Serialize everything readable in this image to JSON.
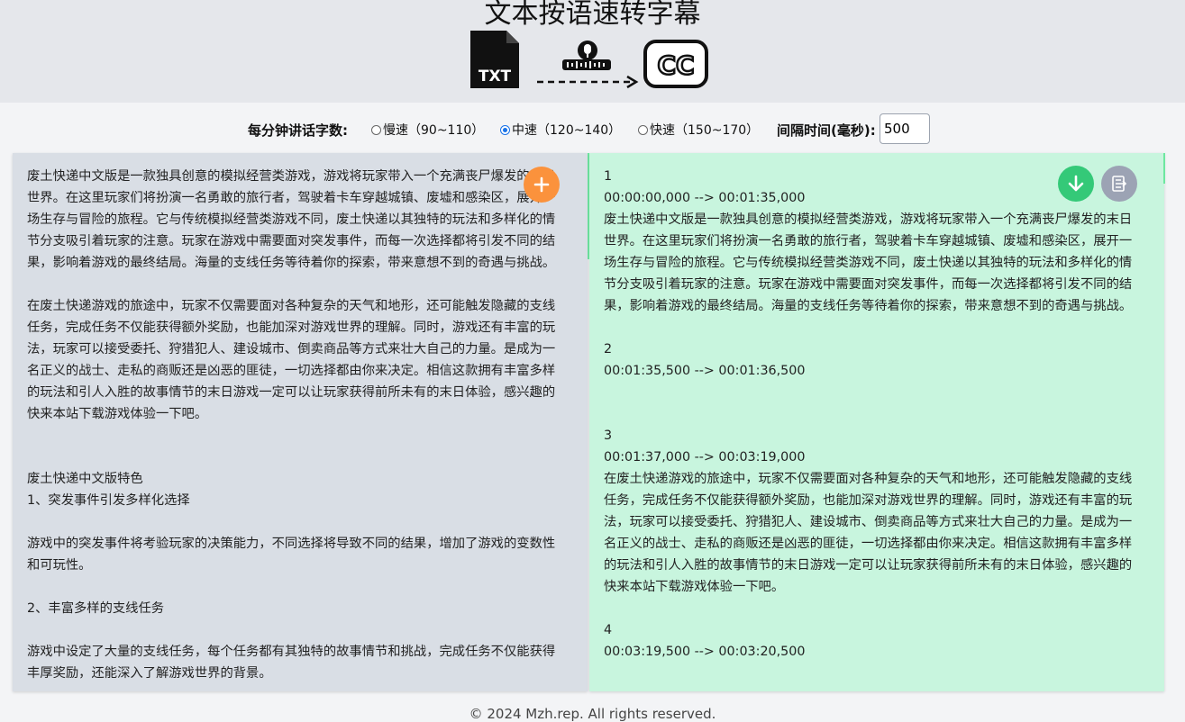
{
  "app": {
    "title": "文本按语速转字幕",
    "logo_text": "TXT",
    "logo_cc": "CC"
  },
  "controls": {
    "rate_label": "每分钟讲话字数:",
    "options": [
      {
        "label": "慢速（90~110）",
        "checked": false
      },
      {
        "label": "中速（120~140）",
        "checked": true
      },
      {
        "label": "快速（150~170）",
        "checked": false
      }
    ],
    "interval_label": "间隔时间(毫秒):",
    "interval_value": "500"
  },
  "input_text": "废土快递中文版是一款独具创意的模拟经营类游戏，游戏将玩家带入一个充满丧尸爆发的末日世界。在这里玩家们将扮演一名勇敢的旅行者，驾驶着卡车穿越城镇、废墟和感染区，展开一场生存与冒险的旅程。它与传统模拟经营类游戏不同，废土快递以其独特的玩法和多样化的情节分支吸引着玩家的注意。玩家在游戏中需要面对突发事件，而每一次选择都将引发不同的结果，影响着游戏的最终结局。海量的支线任务等待着你的探索，带来意想不到的奇遇与挑战。\n\n在废土快递游戏的旅途中，玩家不仅需要面对各种复杂的天气和地形，还可能触发隐藏的支线任务，完成任务不仅能获得额外奖励，也能加深对游戏世界的理解。同时，游戏还有丰富的玩法，玩家可以接受委托、狩猎犯人、建设城市、倒卖商品等方式来壮大自己的力量。是成为一名正义的战士、走私的商贩还是凶恶的匪徒，一切选择都由你来决定。相信这款拥有丰富多样的玩法和引人入胜的故事情节的末日游戏一定可以让玩家获得前所未有的末日体验，感兴趣的快来本站下载游戏体验一下吧。\n\n\n废土快递中文版特色\n1、突发事件引发多样化选择\n\n游戏中的突发事件将考验玩家的决策能力，不同选择将导致不同的结果，增加了游戏的变数性和可玩性。\n\n2、丰富多样的支线任务\n\n游戏中设定了大量的支线任务，每个任务都有其独特的故事情节和挑战，完成任务不仅能获得丰厚奖励，还能深入了解游戏世界的背景。",
  "output_text": "1\n00:00:00,000 --> 00:01:35,000\n废土快递中文版是一款独具创意的模拟经营类游戏，游戏将玩家带入一个充满丧尸爆发的末日世界。在这里玩家们将扮演一名勇敢的旅行者，驾驶着卡车穿越城镇、废墟和感染区，展开一场生存与冒险的旅程。它与传统模拟经营类游戏不同，废土快递以其独特的玩法和多样化的情节分支吸引着玩家的注意。玩家在游戏中需要面对突发事件，而每一次选择都将引发不同的结果，影响着游戏的最终结局。海量的支线任务等待着你的探索，带来意想不到的奇遇与挑战。\n\n2\n00:01:35,500 --> 00:01:36,500\n\n\n3\n00:01:37,000 --> 00:03:19,000\n在废土快递游戏的旅途中，玩家不仅需要面对各种复杂的天气和地形，还可能触发隐藏的支线任务，完成任务不仅能获得额外奖励，也能加深对游戏世界的理解。同时，游戏还有丰富的玩法，玩家可以接受委托、狩猎犯人、建设城市、倒卖商品等方式来壮大自己的力量。是成为一名正义的战士、走私的商贩还是凶恶的匪徒，一切选择都由你来决定。相信这款拥有丰富多样的玩法和引人入胜的故事情节的末日游戏一定可以让玩家获得前所未有的末日体验，感兴趣的快来本站下载游戏体验一下吧。\n\n4\n00:03:19,500 --> 00:03:20,500\n",
  "footer": "© 2024 Mzh.rep. All rights reserved.",
  "colors": {
    "add_button": "#fb923c",
    "download_button": "#34c978",
    "copy_button": "#9ca3b4",
    "output_bg": "#c8f5de",
    "input_bg": "#d9dee5"
  }
}
